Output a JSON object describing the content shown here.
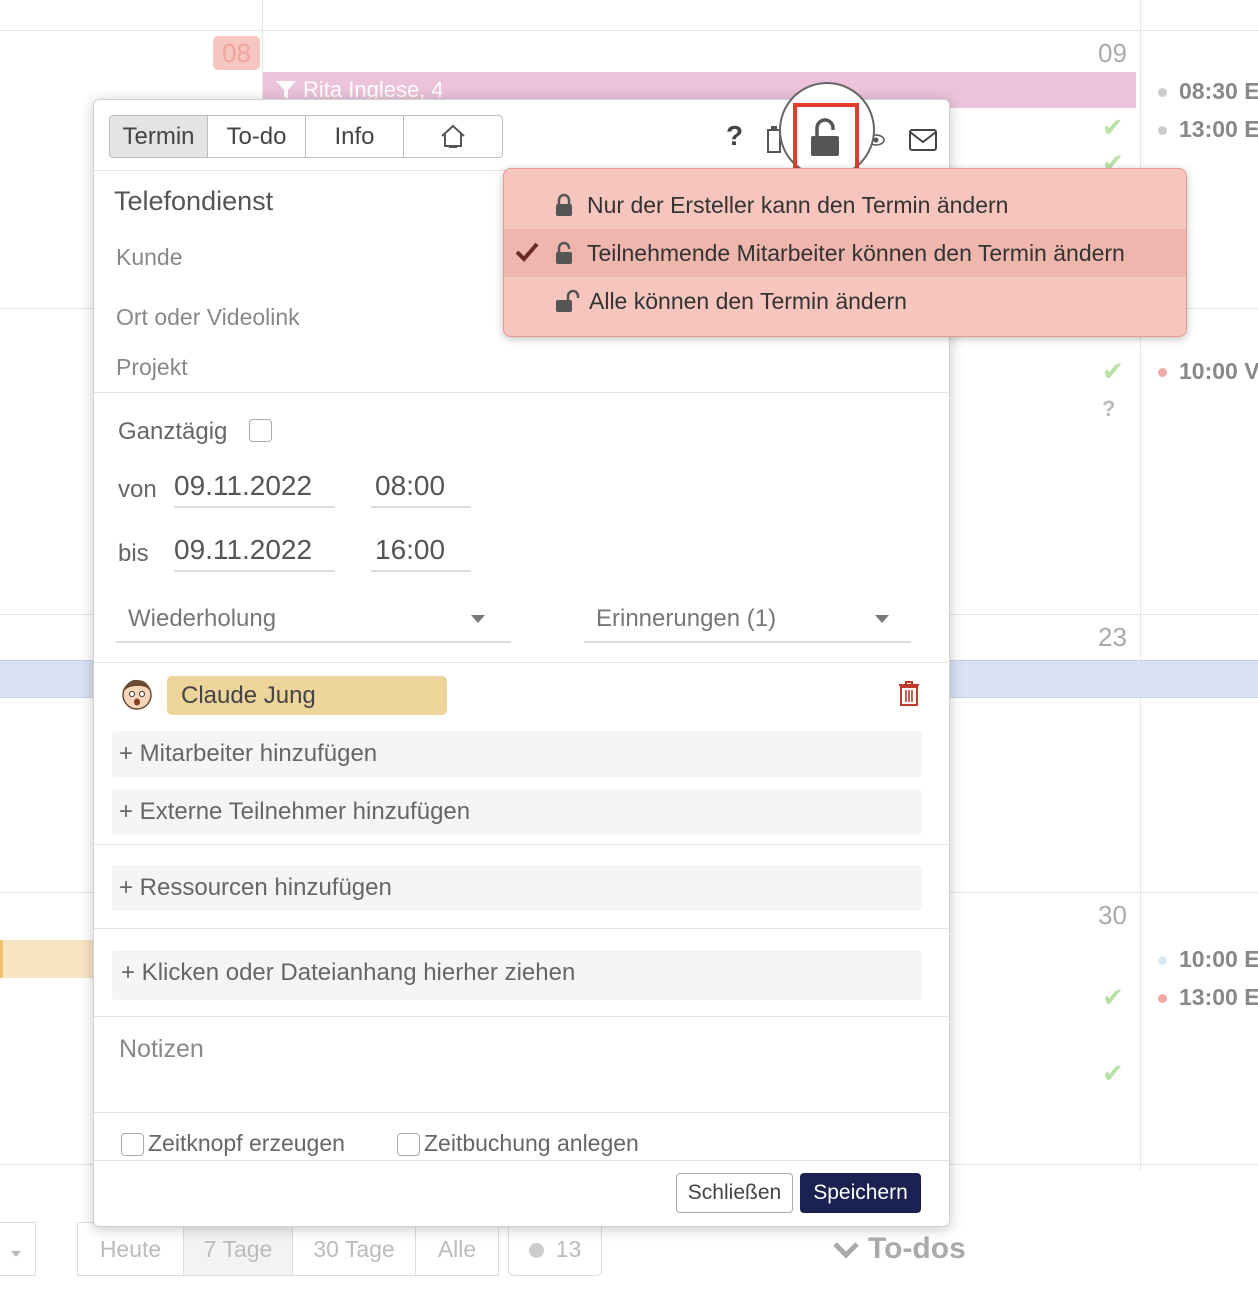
{
  "calendar": {
    "day_badge": "08",
    "day_numbers": {
      "d09": "09",
      "d23": "23",
      "d30": "30"
    },
    "event_title": "Rita Inglese, 4",
    "side_items": [
      {
        "time": "08:30 E",
        "dot_color": "#cccccc"
      },
      {
        "time": "13:00 E",
        "dot_color": "#cccccc"
      },
      {
        "time": "10:00 V",
        "dot_color": "#f0a9a3"
      },
      {
        "time": "10:00 E",
        "dot_color": "#d6e9f7"
      },
      {
        "time": "13:00 E",
        "dot_color": "#f0a9a3"
      }
    ],
    "question_mark": "?"
  },
  "view_switch": {
    "heute": "Heute",
    "sieben_tage": "7 Tage",
    "dreissig_tage": "30 Tage",
    "alle": "Alle",
    "count": "13",
    "todos": "To-dos"
  },
  "dialog": {
    "tabs": {
      "termin": "Termin",
      "todo": "To-do",
      "info": "Info"
    },
    "toolbar": {
      "help": "?"
    },
    "title": "Telefondienst",
    "fields": {
      "kunde": "Kunde",
      "ort": "Ort oder Videolink",
      "projekt": "Projekt"
    },
    "allday_label": "Ganztägig",
    "from": {
      "label": "von",
      "date": "09.11.2022",
      "time": "08:00"
    },
    "to": {
      "label": "bis",
      "date": "09.11.2022",
      "time": "16:00"
    },
    "repeat": "Wiederholung",
    "reminders": "Erinnerungen (1)",
    "participant": "Claude Jung",
    "add_staff": "+ Mitarbeiter hinzufügen",
    "add_external": "+ Externe Teilnehmer hinzufügen",
    "add_resources": "+ Ressourcen hinzufügen",
    "attachment": "+ Klicken oder Dateianhang hierher ziehen",
    "notes": "Notizen",
    "time_button": "Zeitknopf erzeugen",
    "time_booking": "Zeitbuchung anlegen",
    "close": "Schließen",
    "save": "Speichern"
  },
  "permission_menu": [
    {
      "label": "Nur der Ersteller kann den Termin ändern",
      "icon": "lock-closed-icon",
      "selected": false
    },
    {
      "label": "Teilnehmende Mitarbeiter können den Termin ändern",
      "icon": "lock-half-open-icon",
      "selected": true
    },
    {
      "label": "Alle können den Termin ändern",
      "icon": "lock-open-icon",
      "selected": false
    }
  ],
  "colors": {
    "menu_bg": "#f6c5bd",
    "menu_selected_bg": "#efb6ad",
    "save_button": "#1b2150",
    "participant_pill": "#ecd49a",
    "highlight_rect": "#e53b2c"
  }
}
